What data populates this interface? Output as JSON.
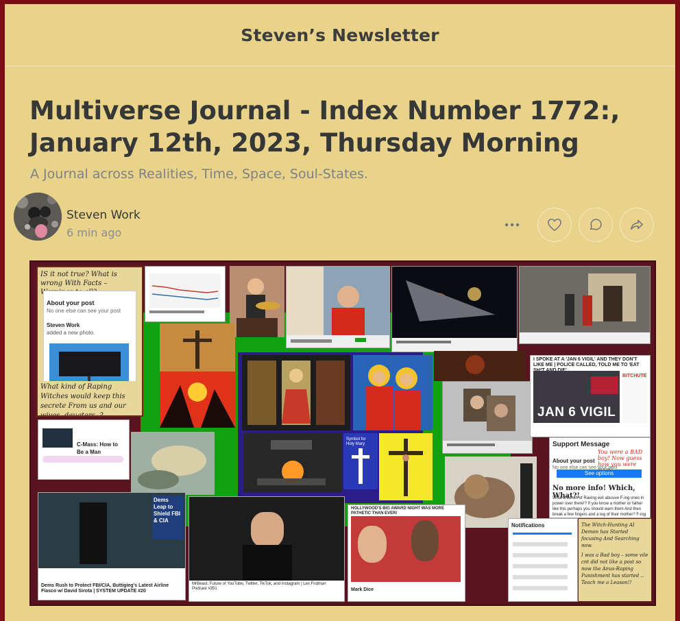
{
  "site": {
    "title": "Steven’s Newsletter"
  },
  "post": {
    "title": "Multiverse Journal - Index Number 1772:, January 12th, 2023, Thursday Morning",
    "subtitle": "A Journal across Realities, Time, Space, Soul-States.",
    "author": "Steven Work",
    "time": "6 min ago"
  },
  "actions": {
    "more": "more-icon",
    "like": "heart-icon",
    "comment": "comment-icon",
    "share": "share-icon"
  },
  "collage": {
    "note_top": "IS it not true? What is wrong With Facts – Warnings to all?",
    "note_bottom": "What kind of Raping Witches would keep this secrete From us and our wives, daugters, ?",
    "fb_title": "About your post",
    "fb_sub": "No one else can see your post",
    "fb_author": "Steven Work",
    "fb_added": "added a new photo.",
    "podcast": "C-Mass: How to Be a Man",
    "dems_leap": "Dems Leap to Shield FBI & CIA",
    "dems_caption": "Dems Rush to Protect FBI/CIA, Buttigieg's Latest Airline Fiasco w/ David Sirota | SYSTEM UPDATE #20",
    "jan6_header": "I SPOKE AT A 'JAN 6 VIGIL' AND THEY DON'T LIKE ME | POLICE CALLED, TOLD ME TO 'EAT SH*T AND DIE'",
    "jan6": "JAN 6 VIGIL",
    "bitchute": "BITCHUTE",
    "support_title": "Support Message",
    "support_note": "You were a BAD boy! Now guess how you were BAD!",
    "support_button": "See options",
    "more_info": "No more info! Which, What?!",
    "witch_text": "What a bunch of Raving evil abusive F-ing ones in power over there!? If you know a mother or father like this perhaps you should warn them And then break a few fingers and a leg of their mother? F-ing Horrors!",
    "hollywood": "HOLLYWOOD'S BIG AWARD NIGHT WAS MORE PATHETIC THAN EVER!",
    "notifications": "Notifications",
    "witch_ai": "The Witch-Hunting AI Demon has Started focusing And Searching now.",
    "bad_boy": "I was a Bad boy – some vile cnt did not like a post so now the Anus-Raping Punishment has started .. Teach me a Leason!!",
    "mrbeast": "MrBeast: Future of YouTube, Twitter, TikTok, and Instagram | Lex Fridman Podcast #351",
    "mark_dice": "Mark Dice",
    "spirit": "Symbol for Holy Mary"
  },
  "colors": {
    "page_bg": "#e9d38a",
    "border": "#7a0e14",
    "title": "#363737",
    "muted": "#7d8188",
    "green": "#14a014"
  }
}
